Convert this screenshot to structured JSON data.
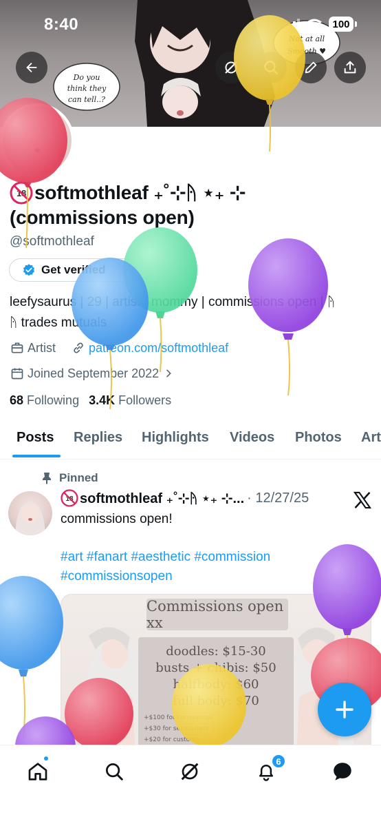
{
  "status_bar": {
    "time": "8:40",
    "battery": "100"
  },
  "header": {
    "back_icon": "arrow-left-icon",
    "grok_icon": "grok-icon",
    "search_icon": "search-icon",
    "edit_icon": "pencil-icon",
    "share_icon": "share-icon",
    "banner_speech_left": [
      "Do you",
      "think they",
      "can tell..?"
    ],
    "banner_speech_right": [
      "Not at all",
      "Smooth ♥"
    ]
  },
  "profile": {
    "name_line1": "softmothleaf ₊˚⊹ᚤ ⋆₊ ⊹",
    "name_line2": "(commissions open)",
    "handle": "@softmothleaf",
    "get_verified": "Get verified",
    "bio_line1": "leefysaurus | 29 | artist | mommy | commissions open | ᚤ",
    "bio_line2": "ᚤ trades mutuals",
    "category": "Artist",
    "website": "patreon.com/softmothleaf",
    "joined": "Joined September 2022",
    "following_count": "68",
    "following_label": "Following",
    "followers_count": "3.4K",
    "followers_label": "Followers"
  },
  "tabs": [
    {
      "label": "Posts",
      "active": true
    },
    {
      "label": "Replies",
      "active": false
    },
    {
      "label": "Highlights",
      "active": false
    },
    {
      "label": "Videos",
      "active": false
    },
    {
      "label": "Photos",
      "active": false
    },
    {
      "label": "Articles",
      "active": false
    }
  ],
  "tweet": {
    "pinned_label": "Pinned",
    "author": "softmothleaf ₊˚⊹ᚤ ⋆₊ ⊹...",
    "date": "· 12/27/25",
    "text": "commissions open!",
    "hashtags_line1": "#art #fanart #aesthetic #commission",
    "hashtags_line2": "#commissionsopen",
    "media": {
      "title": "Commissions open xx",
      "prices": [
        "doodles: $15-30",
        "busts + chibis: $50",
        "halfbody: $60",
        "full body: $70"
      ],
      "notes": [
        "+$100 for commercial",
        "+$30 for set starters",
        "+$20 for customs"
      ]
    }
  },
  "bottom_nav": {
    "items": [
      "home-icon",
      "search-icon",
      "grok-icon",
      "bell-icon",
      "messages-icon"
    ],
    "notifications_badge": "6"
  },
  "colors": {
    "accent": "#1d9bf0",
    "text_primary": "#0f1419",
    "text_secondary": "#536471",
    "balloon_red": "#e8405a",
    "balloon_yellow": "#f3d23a",
    "balloon_green": "#5fe0a8",
    "balloon_blue": "#4aa3f0",
    "balloon_purple": "#9b47e6"
  }
}
